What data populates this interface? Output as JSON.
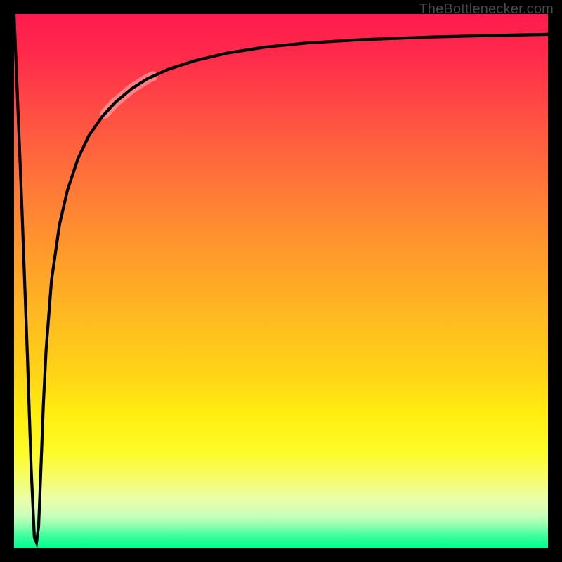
{
  "attribution": "TheBottlenecker.com",
  "chart_data": {
    "type": "line",
    "title": "",
    "xlabel": "",
    "ylabel": "",
    "xlim": [
      0,
      100
    ],
    "ylim": [
      0,
      100
    ],
    "notes": "Background encodes a smooth red→yellow→green gradient (top→bottom). Curve enters top-left near (0,100), falls in a sharp narrow V to a minimum near x≈4 at y≈0, then rises steeply and asymptotically approaches y≈96 at the right edge. A faint highlight segment overlays the curve around x≈17–26.",
    "series": [
      {
        "name": "bottleneck-curve",
        "x": [
          0.0,
          0.5,
          1.5,
          2.5,
          3.2,
          3.8,
          4.2,
          4.6,
          5.0,
          5.5,
          6.0,
          7.0,
          8.5,
          10.0,
          12.0,
          14.0,
          16.5,
          19.0,
          22.0,
          25.0,
          29.0,
          34.0,
          40.0,
          47.0,
          55.0,
          65.0,
          78.0,
          90.0,
          100.0
        ],
        "y": [
          100.0,
          88.0,
          63.0,
          36.0,
          15.0,
          2.0,
          1.0,
          4.0,
          14.0,
          27.0,
          37.0,
          50.0,
          60.5,
          67.0,
          73.0,
          77.2,
          80.8,
          83.5,
          86.0,
          87.9,
          89.7,
          91.3,
          92.7,
          93.8,
          94.6,
          95.2,
          95.7,
          96.0,
          96.2
        ]
      }
    ],
    "highlight_segment": {
      "x_start": 17.0,
      "x_end": 26.0,
      "color_rgba": "rgba(255,255,255,0.35)"
    },
    "background_gradient": {
      "top_color": "#ff1a4d",
      "mid_color": "#ffee10",
      "bottom_color": "#00ff90"
    }
  }
}
